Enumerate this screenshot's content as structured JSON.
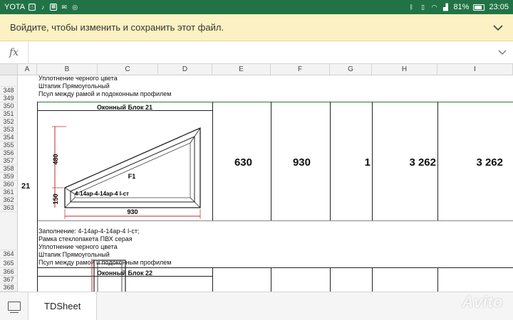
{
  "status_bar": {
    "carrier": "YOTA",
    "battery": "81%",
    "time": "23:05"
  },
  "banner": {
    "message": "Войдите, чтобы изменить и сохранить этот файл."
  },
  "formula_bar": {
    "fx_label": "fx",
    "value": ""
  },
  "columns": [
    "A",
    "B",
    "C",
    "D",
    "E",
    "F",
    "G",
    "H",
    "I"
  ],
  "rows": [
    "348",
    "349",
    "350",
    "351",
    "352",
    "353",
    "354",
    "355",
    "356",
    "357",
    "358",
    "359",
    "360",
    "361",
    "362",
    "363",
    "364",
    "365",
    "366",
    "367",
    "368"
  ],
  "block1": {
    "top_lines": [
      "Уплотнение черного цвета",
      "Штапик Прямоугольный",
      "Псул между рамой и подоконным профилем"
    ],
    "row_label": "21",
    "title": "Оконный Блок 21",
    "dim_height": "480",
    "dim_side": "150",
    "dim_width": "930",
    "label_f1": "F1",
    "glass_label": "4-14ар-4-14ар-4 I-ст",
    "width_value": "630",
    "height_value": "930",
    "qty_value": "1",
    "price_value": "3 262",
    "sum_value": "3 262",
    "description": [
      "Заполнение: 4-14ар-4-14ар-4 I-ст;",
      "Рамка стеклопакета ПВХ серая",
      "Уплотнение черного цвета",
      "Штапик Прямоугольный",
      "Псул между рамой и подоконным профилем"
    ]
  },
  "block2": {
    "title": "Оконный Блок 22"
  },
  "sheet_tabs": [
    {
      "label": "TDSheet"
    }
  ],
  "watermark": "Avito"
}
